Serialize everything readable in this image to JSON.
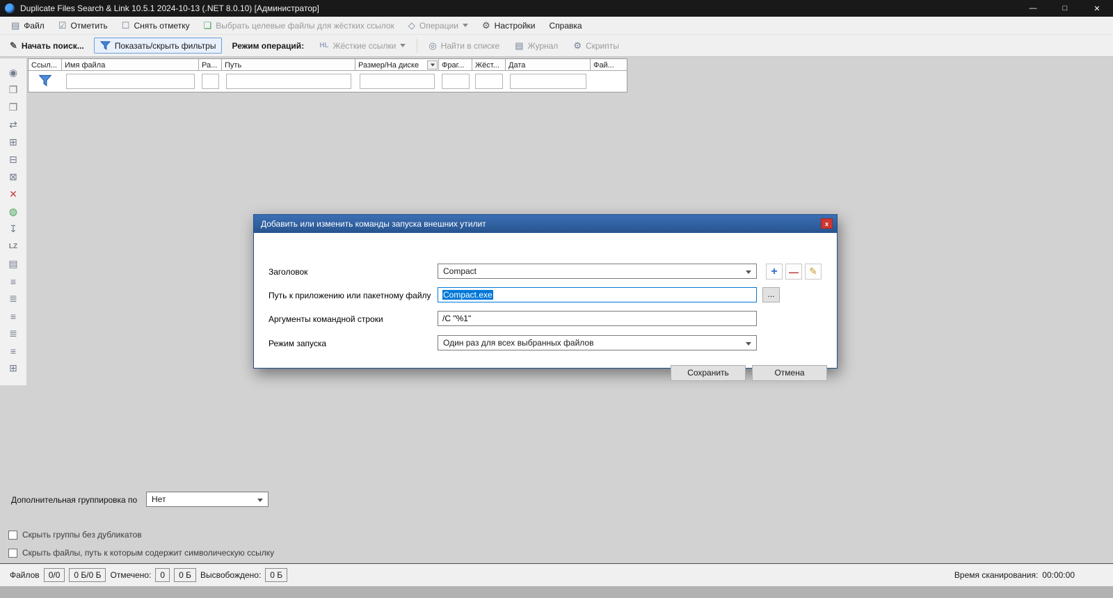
{
  "colors": {
    "titlebar_bg": "#191919",
    "toolbar_bg": "#f0f0f0",
    "workspace_bg": "#d2d2d2",
    "dialog_title_blue": "#2b5fa7",
    "selection_blue": "#0078d7",
    "close_red": "#cf3732",
    "accent_funnel_blue": "#3f84d6"
  },
  "window": {
    "title": "Duplicate Files Search & Link 10.5.1 2024-10-13 (.NET 8.0.10) [Администратор]",
    "minimize_glyph": "—",
    "maximize_glyph": "□",
    "close_glyph": "✕"
  },
  "menubar": {
    "items": [
      {
        "name": "file",
        "label": "Файл",
        "glyph": "▤"
      },
      {
        "name": "mark",
        "label": "Отметить",
        "glyph": "☑"
      },
      {
        "name": "unmark",
        "label": "Снять отметку",
        "glyph": "☐"
      },
      {
        "name": "select-target-files",
        "label": "Выбрать целевые файлы для жёстких ссылок",
        "glyph": "❏"
      },
      {
        "name": "operations",
        "label": "Операции",
        "glyph": "◇"
      },
      {
        "name": "settings",
        "label": "Настройки",
        "glyph": "⚙"
      },
      {
        "name": "help",
        "label": "Справка",
        "glyph": ""
      }
    ]
  },
  "toolbar": {
    "start_search": {
      "label": "Начать поиск...",
      "glyph": "✎"
    },
    "toggle_filters": {
      "label": "Показать/скрыть фильтры"
    },
    "operation_mode_label": "Режим операций:",
    "hard_links": {
      "label": "Жёсткие ссылки",
      "glyph": "HL"
    },
    "find_in_list": {
      "label": "Найти в списке",
      "glyph": "◎"
    },
    "journal": {
      "label": "Журнал",
      "glyph": "▤"
    },
    "scripts": {
      "label": "Скрипты",
      "glyph": "⚙"
    }
  },
  "table": {
    "columns": [
      "Ссыл...",
      "Имя файла",
      "Ра...",
      "Путь",
      "Размер/На диске",
      "Фраг...",
      "Жёст...",
      "Дата",
      "Фай..."
    ]
  },
  "sidebar": {
    "icons": [
      {
        "name": "preview-icon",
        "glyph": "◉"
      },
      {
        "name": "copy-icon",
        "glyph": "❐"
      },
      {
        "name": "paste-icon",
        "glyph": "❐"
      },
      {
        "name": "swap-icon",
        "glyph": "⇄"
      },
      {
        "name": "group-link-icon",
        "glyph": "⊞"
      },
      {
        "name": "group-unlink-icon",
        "glyph": "⊟"
      },
      {
        "name": "group-clear-icon",
        "glyph": "⊠"
      },
      {
        "name": "delete-icon",
        "glyph": "✕"
      },
      {
        "name": "network-icon",
        "glyph": "◍"
      },
      {
        "name": "export-icon",
        "glyph": "↧"
      },
      {
        "name": "lz-compress-icon",
        "glyph": "LZ"
      },
      {
        "name": "folder-icon",
        "glyph": "▤"
      },
      {
        "name": "hardlink-1-icon",
        "glyph": "≡"
      },
      {
        "name": "hardlink-2-icon",
        "glyph": "≣"
      },
      {
        "name": "hardlink-3-icon",
        "glyph": "≡"
      },
      {
        "name": "hardlink-4-icon",
        "glyph": "≣"
      },
      {
        "name": "hardlink-5-icon",
        "glyph": "≡"
      },
      {
        "name": "hardlink-6-icon",
        "glyph": "⊞"
      }
    ]
  },
  "dialog": {
    "title": "Добавить или изменить команды запуска внешних утилит",
    "close_glyph": "x",
    "fields": {
      "title_label": "Заголовок",
      "title_value": "Compact",
      "path_label": "Путь к приложению или пакетному файлу",
      "path_value": "Compact.exe",
      "args_label": "Аргументы командной строки",
      "args_value": "/C \"%1\"",
      "mode_label": "Режим запуска",
      "mode_value": "Один раз для всех выбранных файлов"
    },
    "buttons": {
      "add_glyph": "+",
      "remove_glyph": "—",
      "edit_glyph": "✎",
      "browse": "...",
      "save": "Сохранить",
      "cancel": "Отмена"
    }
  },
  "grouping": {
    "label": "Дополнительная группировка по",
    "value": "Нет"
  },
  "checkboxes": {
    "hide_groups": {
      "label": "Скрыть группы без дубликатов",
      "checked": false
    },
    "hide_symlink": {
      "label": "Скрыть файлы, путь к которым содержит символическую ссылку",
      "checked": false
    }
  },
  "statusbar": {
    "files_label": "Файлов",
    "files_value": "0/0",
    "size_value": "0 Б/0 Б",
    "marked_label": "Отмечено:",
    "marked_count": "0",
    "marked_size": "0 Б",
    "freed_label": "Высвобождено:",
    "freed_value": "0 Б",
    "scan_time_label": "Время сканирования:",
    "scan_time_value": "00:00:00"
  }
}
